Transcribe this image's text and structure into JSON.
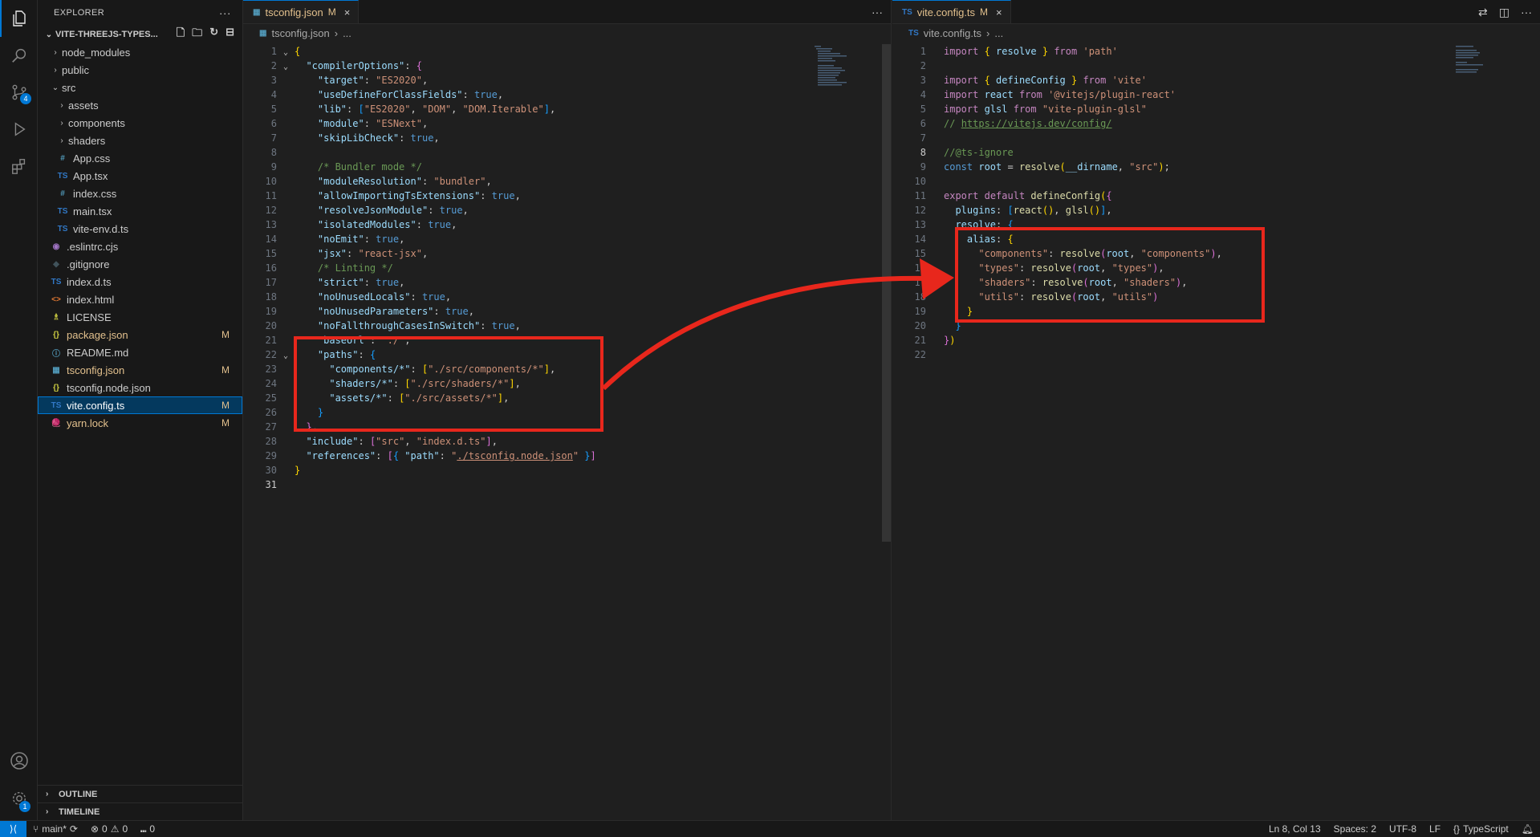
{
  "explorer": {
    "title": "EXPLORER",
    "more": "···",
    "project": "VITE-THREEJS-TYPES...",
    "items": [
      {
        "label": "node_modules",
        "type": "folder",
        "depth": 1,
        "open": false
      },
      {
        "label": "public",
        "type": "folder",
        "depth": 1,
        "open": false
      },
      {
        "label": "src",
        "type": "folder",
        "depth": 1,
        "open": true
      },
      {
        "label": "assets",
        "type": "folder",
        "depth": 2,
        "open": false
      },
      {
        "label": "components",
        "type": "folder",
        "depth": 2,
        "open": false
      },
      {
        "label": "shaders",
        "type": "folder",
        "depth": 2,
        "open": false
      },
      {
        "label": "App.css",
        "type": "css",
        "depth": 2,
        "icon": "#"
      },
      {
        "label": "App.tsx",
        "type": "ts",
        "depth": 2,
        "icon": "TS"
      },
      {
        "label": "index.css",
        "type": "css",
        "depth": 2,
        "icon": "#"
      },
      {
        "label": "main.tsx",
        "type": "ts",
        "depth": 2,
        "icon": "TS"
      },
      {
        "label": "vite-env.d.ts",
        "type": "ts",
        "depth": 2,
        "icon": "TS"
      },
      {
        "label": ".eslintrc.cjs",
        "type": "eslint",
        "depth": 1,
        "icon": "◉"
      },
      {
        "label": ".gitignore",
        "type": "git",
        "depth": 1,
        "icon": "◆"
      },
      {
        "label": "index.d.ts",
        "type": "ts",
        "depth": 1,
        "icon": "TS"
      },
      {
        "label": "index.html",
        "type": "html",
        "depth": 1,
        "icon": "<>"
      },
      {
        "label": "LICENSE",
        "type": "license",
        "depth": 1,
        "icon": "♗"
      },
      {
        "label": "package.json",
        "type": "json",
        "depth": 1,
        "icon": "{}",
        "status": "M"
      },
      {
        "label": "README.md",
        "type": "md",
        "depth": 1,
        "icon": "ⓘ"
      },
      {
        "label": "tsconfig.json",
        "type": "tsconfig",
        "depth": 1,
        "icon": "▦",
        "status": "M"
      },
      {
        "label": "tsconfig.node.json",
        "type": "json",
        "depth": 1,
        "icon": "{}"
      },
      {
        "label": "vite.config.ts",
        "type": "ts",
        "depth": 1,
        "icon": "TS",
        "status": "M",
        "selected": true
      },
      {
        "label": "yarn.lock",
        "type": "yarn",
        "depth": 1,
        "icon": "🧶",
        "status": "M"
      }
    ],
    "outline": "OUTLINE",
    "timeline": "TIMELINE"
  },
  "left_editor": {
    "tab": {
      "icon": "▦",
      "label": "tsconfig.json",
      "modified": "M",
      "close": "×"
    },
    "breadcrumb": {
      "file": "tsconfig.json",
      "rest": "..."
    },
    "more": "···"
  },
  "right_editor": {
    "tab": {
      "icon": "TS",
      "label": "vite.config.ts",
      "modified": "M",
      "close": "×"
    },
    "breadcrumb": {
      "file": "vite.config.ts",
      "rest": "..."
    }
  },
  "status": {
    "branch": "main*",
    "errors": "0",
    "warnings": "0",
    "ports": "0",
    "position": "Ln 8, Col 13",
    "spaces": "Spaces: 2",
    "encoding": "UTF-8",
    "eol": "LF",
    "language": "TypeScript"
  },
  "colors": {
    "accent": "#0078d4",
    "modified": "#e2c08d",
    "annotation": "#e8271c"
  }
}
